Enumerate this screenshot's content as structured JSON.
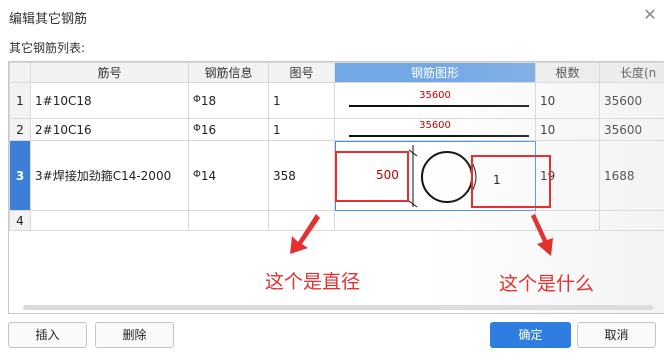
{
  "dialog": {
    "title": "编辑其它钢筋",
    "close_glyph": "✕",
    "list_caption": "其它钢筋列表:"
  },
  "table": {
    "columns": [
      "",
      "筋号",
      "钢筋信息",
      "图号",
      "钢筋图形",
      "根数",
      "长度(n"
    ],
    "rows": [
      {
        "num": "1",
        "name": "1#10C18",
        "info_symbol": "Φ",
        "info": "18",
        "fig": "1",
        "shape_value": "35600",
        "count": "10",
        "length": "35600"
      },
      {
        "num": "2",
        "name": "2#10C16",
        "info_symbol": "Φ",
        "info": "16",
        "fig": "1",
        "shape_value": "35600",
        "count": "10",
        "length": "35600"
      },
      {
        "num": "3",
        "name": "3#焊接加劲箍C14-2000",
        "info_symbol": "Φ",
        "info": "14",
        "fig": "358",
        "shape_diameter": "500",
        "shape_count": "1",
        "count": "19",
        "length": "1688"
      },
      {
        "num": "4",
        "name": "",
        "info_symbol": "",
        "info": "",
        "fig": "",
        "count": "",
        "length": ""
      }
    ]
  },
  "annotations": {
    "left_note": "这个是直径",
    "right_note": "这个是什么",
    "color": "#e53030"
  },
  "buttons": {
    "insert": "插入",
    "delete": "删除",
    "ok": "确定",
    "cancel": "取消"
  },
  "colors": {
    "accent": "#2f7de1",
    "header_active": "#73a8e6",
    "shape_label": "#c00000"
  }
}
